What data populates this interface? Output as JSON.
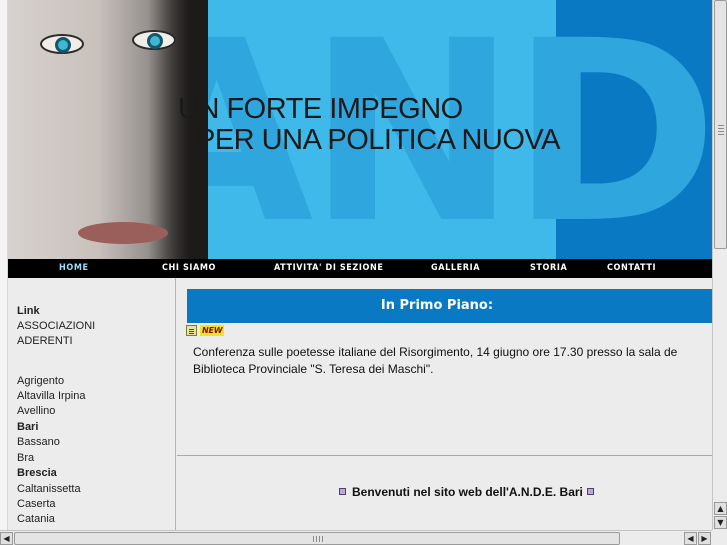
{
  "banner": {
    "headline_line1": "UN FORTE IMPEGNO",
    "headline_line2": "PER UNA POLITICA NUOVA",
    "ghost_letters": "ANDE"
  },
  "nav": {
    "items": [
      {
        "label": "HOME",
        "active": true
      },
      {
        "label": "CHI SIAMO",
        "active": false
      },
      {
        "label": "ATTIVITA' DI SEZIONE",
        "active": false
      },
      {
        "label": "GALLERIA",
        "active": false
      },
      {
        "label": "STORIA",
        "active": false
      },
      {
        "label": "CONTATTI",
        "active": false
      }
    ]
  },
  "sidebar": {
    "heading": "Link",
    "links": [
      "ASSOCIAZIONI",
      "ADERENTI"
    ],
    "cities": [
      {
        "name": "Agrigento",
        "bold": false
      },
      {
        "name": "Altavilla Irpina",
        "bold": false
      },
      {
        "name": "Avellino",
        "bold": false
      },
      {
        "name": "Bari",
        "bold": true
      },
      {
        "name": "Bassano",
        "bold": false
      },
      {
        "name": "Bra",
        "bold": false
      },
      {
        "name": "Brescia",
        "bold": true
      },
      {
        "name": "Caltanissetta",
        "bold": false
      },
      {
        "name": "Caserta",
        "bold": false
      },
      {
        "name": "Catania",
        "bold": false
      }
    ]
  },
  "main": {
    "primo_piano": "In Primo Piano:",
    "new_badge": "NEW",
    "news_line1": "Conferenza sulle poetesse italiane del Risorgimento, 14 giugno ore 17.30 presso la sala de",
    "news_line2": "Biblioteca Provinciale \"S. Teresa dei Maschi\".",
    "welcome": "Benvenuti  nel sito web dell'A.N.D.E. Bari"
  },
  "colors": {
    "banner_light_blue": "#3fb9ea",
    "banner_dark_blue": "#0a79c3",
    "nav_bg": "#000000",
    "content_bg": "#ececec"
  }
}
